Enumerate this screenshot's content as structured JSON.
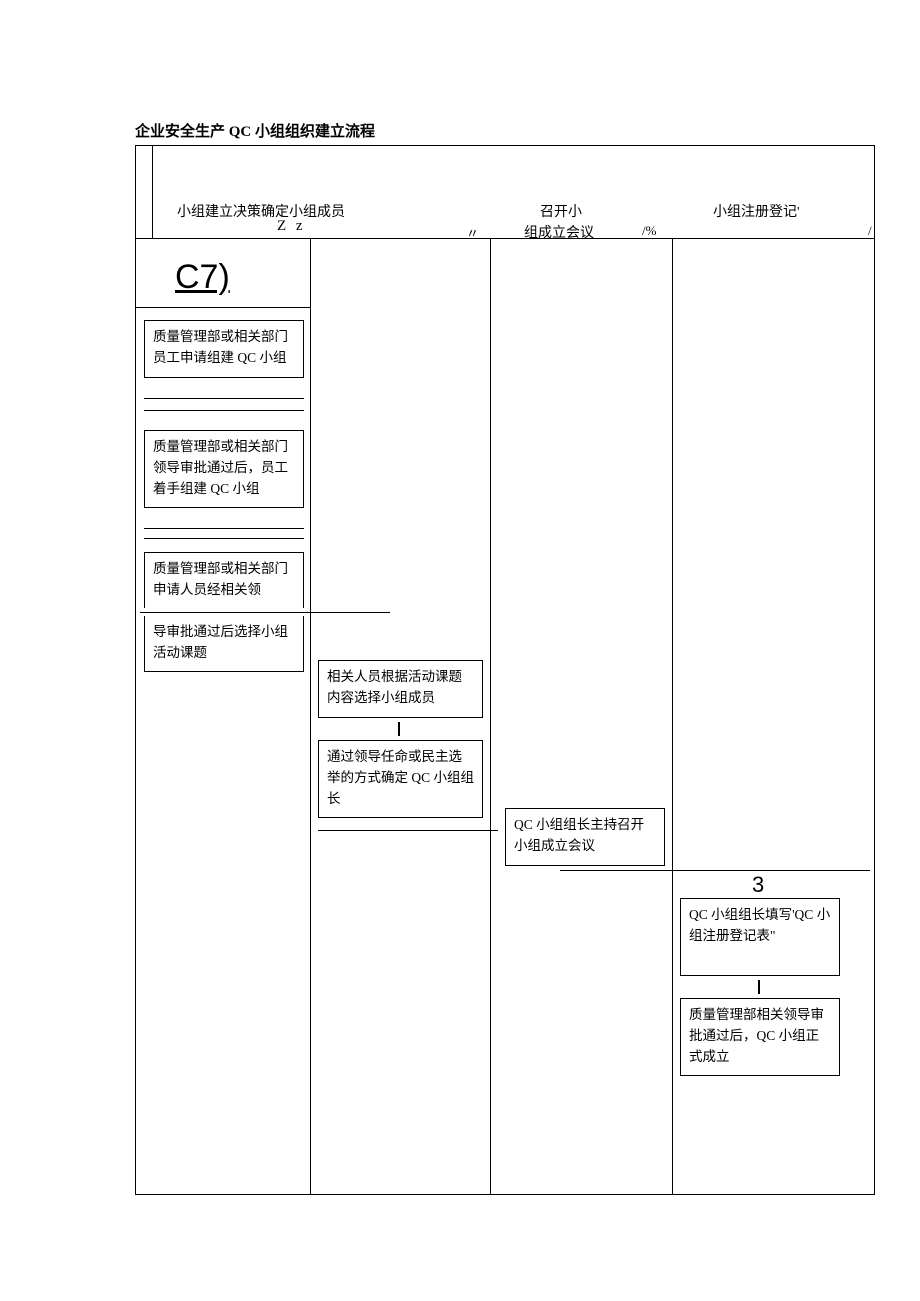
{
  "title": "企业安全生产 QC 小组组织建立流程",
  "header": {
    "col1": "小组建立决策确定小组成员",
    "zz": "Z z",
    "dq": "〃",
    "col2a": "召开小",
    "col2b": "组成立会议",
    "pct": "/%",
    "col3": "小组注册登记'",
    "slash": "/"
  },
  "labels": {
    "c7": "C7)",
    "three": "3"
  },
  "boxes": {
    "a": "质量管理部或相关部门员工申请组建 QC 小组",
    "b": "质量管理部或相关部门领导审批通过后，员工着手组建 QC 小组",
    "c_top": "质量管理部或相关部门申请人员经相关领",
    "c_bot": "导审批通过后选择小组活动课题",
    "d": "相关人员根据活动课题内容选择小组成员",
    "e": "通过领导任命或民主选举的方式确定 QC 小组组长",
    "f": "QC 小组组长主持召开小组成立会议",
    "g": "QC 小组组长填写'QC 小组注册登记表\"",
    "h": "质量管理部相关领导审批通过后，QC 小组正式成立"
  }
}
